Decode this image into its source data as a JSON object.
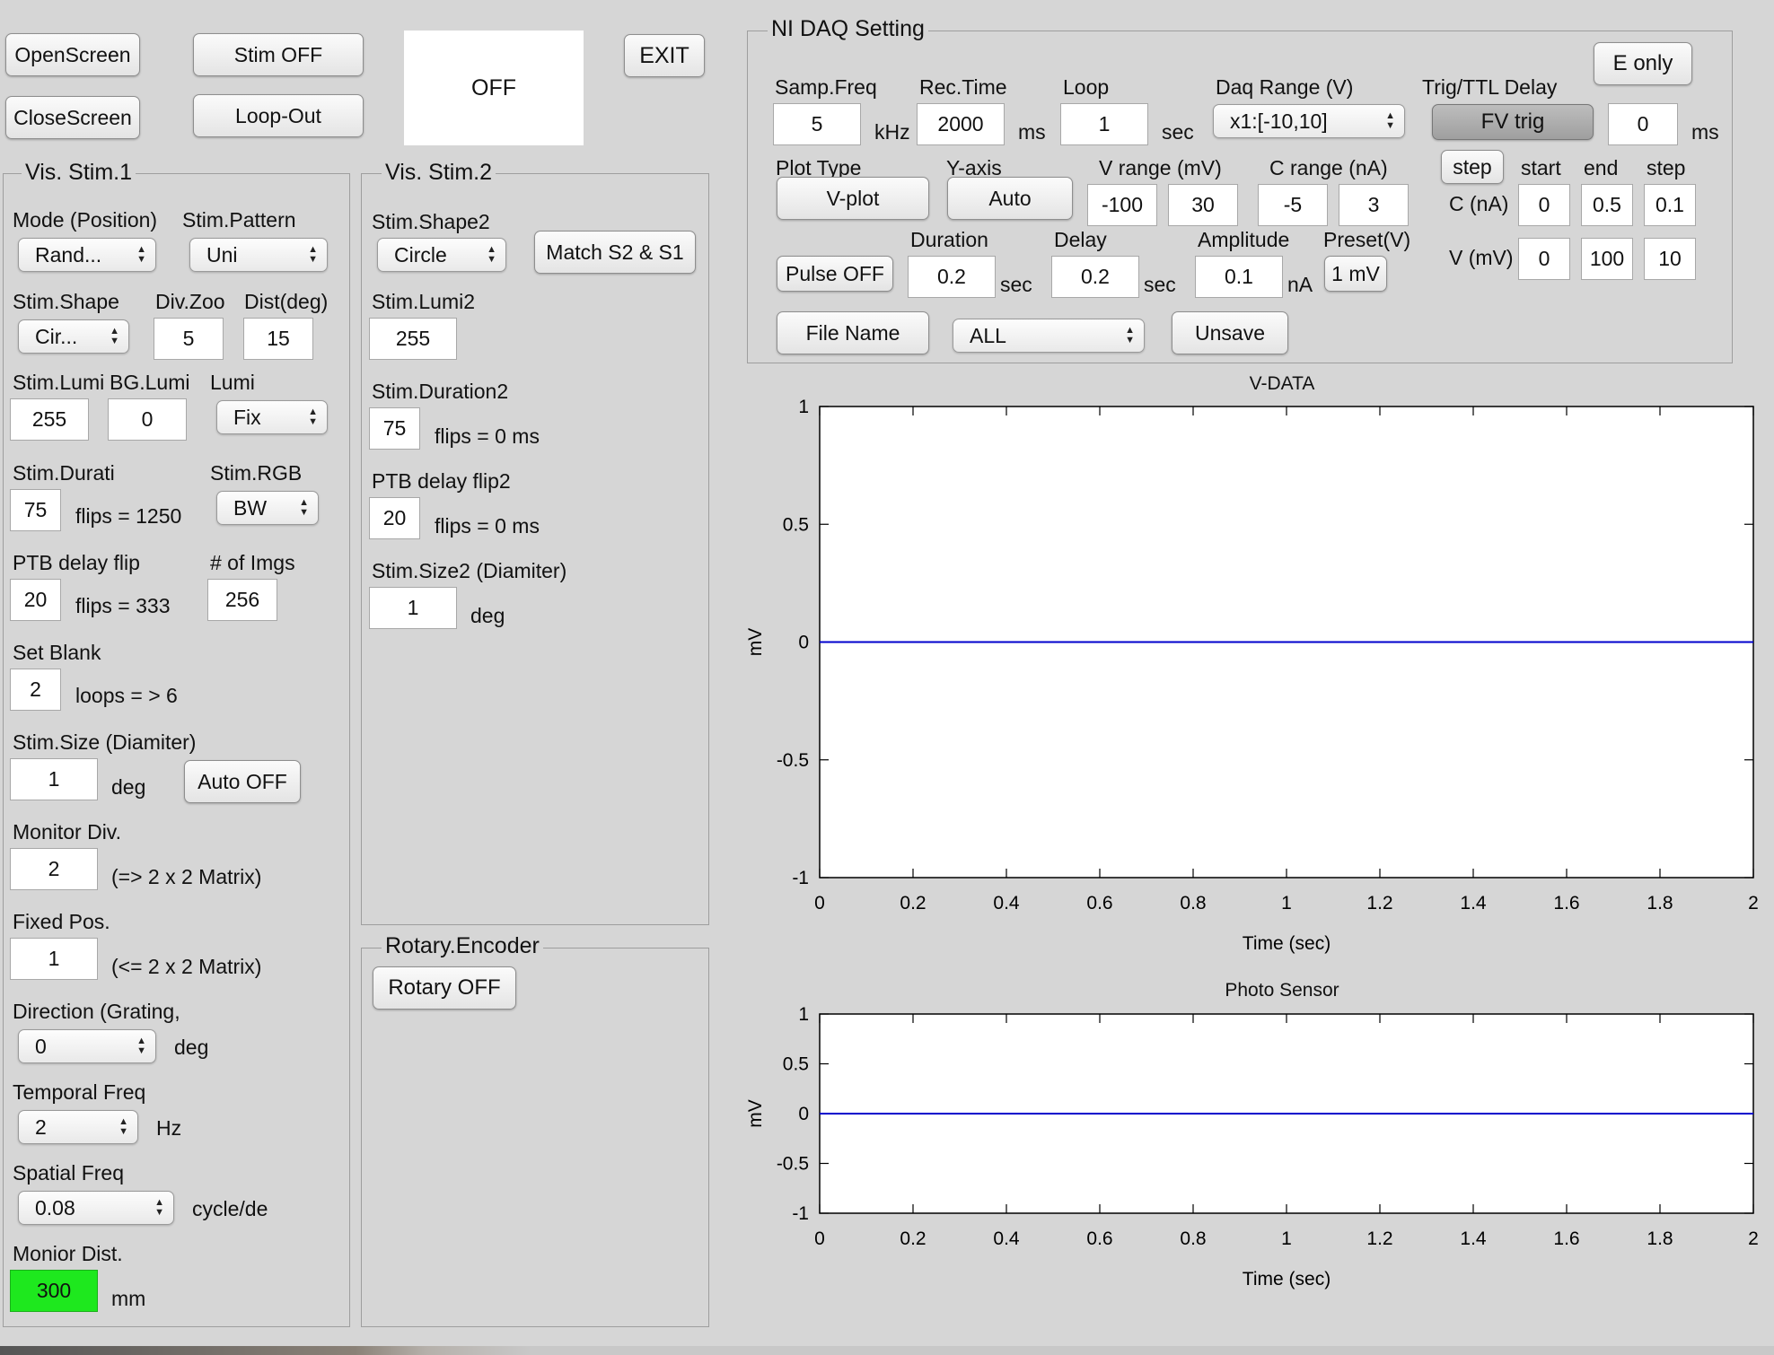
{
  "top": {
    "open_screen": "OpenScreen",
    "close_screen": "CloseScreen",
    "stim_off": "Stim OFF",
    "loop_out": "Loop-Out",
    "status": "OFF",
    "exit": "EXIT"
  },
  "vis1": {
    "title": "Vis. Stim.1",
    "mode_label": "Mode (Position)",
    "mode_value": "Rand...",
    "pattern_label": "Stim.Pattern",
    "pattern_value": "Uni",
    "shape_label": "Stim.Shape",
    "shape_value": "Cir...",
    "divzoo_label": "Div.Zoo",
    "divzoo_value": "5",
    "dist_label": "Dist(deg)",
    "dist_value": "15",
    "lumi_label": "Stim.Lumi",
    "lumi_value": "255",
    "bglumi_label": "BG.Lumi",
    "bglumi_value": "0",
    "lumi_mode_label": "Lumi",
    "lumi_mode_value": "Fix",
    "duration_label": "Stim.Durati",
    "duration_value": "75",
    "duration_note": "flips = 1250",
    "rgb_label": "Stim.RGB",
    "rgb_value": "BW",
    "ptb_label": "PTB delay flip",
    "ptb_value": "20",
    "ptb_note": "flips = 333",
    "imgs_label": "# of Imgs",
    "imgs_value": "256",
    "blank_label": "Set Blank",
    "blank_value": "2",
    "blank_note": "loops = > 6",
    "size_label": "Stim.Size (Diamiter)",
    "size_value": "1",
    "size_unit": "deg",
    "auto_off": "Auto OFF",
    "monitor_div_label": "Monitor Div.",
    "monitor_div_value": "2",
    "monitor_div_note": "(=> 2 x 2 Matrix)",
    "fixed_pos_label": "Fixed Pos.",
    "fixed_pos_value": "1",
    "fixed_pos_note": "(<= 2 x 2 Matrix)",
    "direction_label": "Direction (Grating,",
    "direction_value": "0",
    "direction_unit": "deg",
    "temporal_label": "Temporal Freq",
    "temporal_value": "2",
    "temporal_unit": "Hz",
    "spatial_label": "Spatial Freq",
    "spatial_value": "0.08",
    "spatial_unit": "cycle/de",
    "monitor_dist_label": "Monior Dist.",
    "monitor_dist_value": "300",
    "monitor_dist_unit": "mm"
  },
  "vis2": {
    "title": "Vis. Stim.2",
    "shape_label": "Stim.Shape2",
    "shape_value": "Circle",
    "match": "Match S2 & S1",
    "lumi_label": "Stim.Lumi2",
    "lumi_value": "255",
    "duration_label": "Stim.Duration2",
    "duration_value": "75",
    "duration_note": "flips = 0 ms",
    "ptb_label": "PTB delay flip2",
    "ptb_value": "20",
    "ptb_note": "flips = 0 ms",
    "size_label": "Stim.Size2 (Diamiter)",
    "size_value": "1",
    "size_unit": "deg"
  },
  "rotary": {
    "title": "Rotary.Encoder",
    "button": "Rotary OFF"
  },
  "daq": {
    "title": "NI DAQ Setting",
    "e_only": "E only",
    "samp_label": "Samp.Freq",
    "samp_value": "5",
    "samp_unit": "kHz",
    "rec_label": "Rec.Time",
    "rec_value": "2000",
    "rec_unit": "ms",
    "loop_label": "Loop",
    "loop_value": "1",
    "loop_unit": "sec",
    "range_label": "Daq Range (V)",
    "range_value": "x1:[-10,10]",
    "trig_label": "Trig/TTL Delay",
    "fv_trig": "FV trig",
    "trig_value": "0",
    "trig_unit": "ms",
    "plot_type_label": "Plot Type",
    "plot_type": "V-plot",
    "yaxis_label": "Y-axis",
    "yaxis": "Auto",
    "vrange_label": "V range (mV)",
    "vrange_min": "-100",
    "vrange_max": "30",
    "crange_label": "C range (nA)",
    "crange_min": "-5",
    "crange_max": "3",
    "step_button": "step",
    "start_label": "start",
    "end_label": "end",
    "step_label": "step",
    "c_label": "C (nA)",
    "c_start": "0",
    "c_end": "0.5",
    "c_step": "0.1",
    "v_label": "V (mV)",
    "v_start": "0",
    "v_end": "100",
    "v_step": "10",
    "pulse": "Pulse OFF",
    "duration_label": "Duration",
    "duration_value": "0.2",
    "duration_unit": "sec",
    "delay_label": "Delay",
    "delay_value": "0.2",
    "delay_unit": "sec",
    "amp_label": "Amplitude",
    "amp_value": "0.1",
    "amp_unit": "nA",
    "preset_label": "Preset(V)",
    "preset": "1 mV",
    "file_name": "File Name",
    "file_select": "ALL",
    "unsave": "Unsave"
  },
  "chart_data": [
    {
      "type": "line",
      "title": "V-DATA",
      "xlabel": "Time (sec)",
      "ylabel": "mV",
      "xlim": [
        0,
        2
      ],
      "ylim": [
        -1,
        1
      ],
      "x_ticks": [
        "0",
        "0.2",
        "0.4",
        "0.6",
        "0.8",
        "1",
        "1.2",
        "1.4",
        "1.6",
        "1.8",
        "2"
      ],
      "y_ticks": [
        "1",
        "0.5",
        "0",
        "-0.5",
        "-1"
      ],
      "series": [
        {
          "x": [
            0,
            2
          ],
          "y": [
            0,
            0
          ],
          "color": "#0000cc"
        }
      ]
    },
    {
      "type": "line",
      "title": "Photo Sensor",
      "xlabel": "Time (sec)",
      "ylabel": "mV",
      "xlim": [
        0,
        2
      ],
      "ylim": [
        -1,
        1
      ],
      "x_ticks": [
        "0",
        "0.2",
        "0.4",
        "0.6",
        "0.8",
        "1",
        "1.2",
        "1.4",
        "1.6",
        "1.8",
        "2"
      ],
      "y_ticks": [
        "1",
        "0.5",
        "0",
        "-0.5",
        "-1"
      ],
      "series": [
        {
          "x": [
            0,
            2
          ],
          "y": [
            0,
            0
          ],
          "color": "#0000cc"
        }
      ]
    }
  ]
}
